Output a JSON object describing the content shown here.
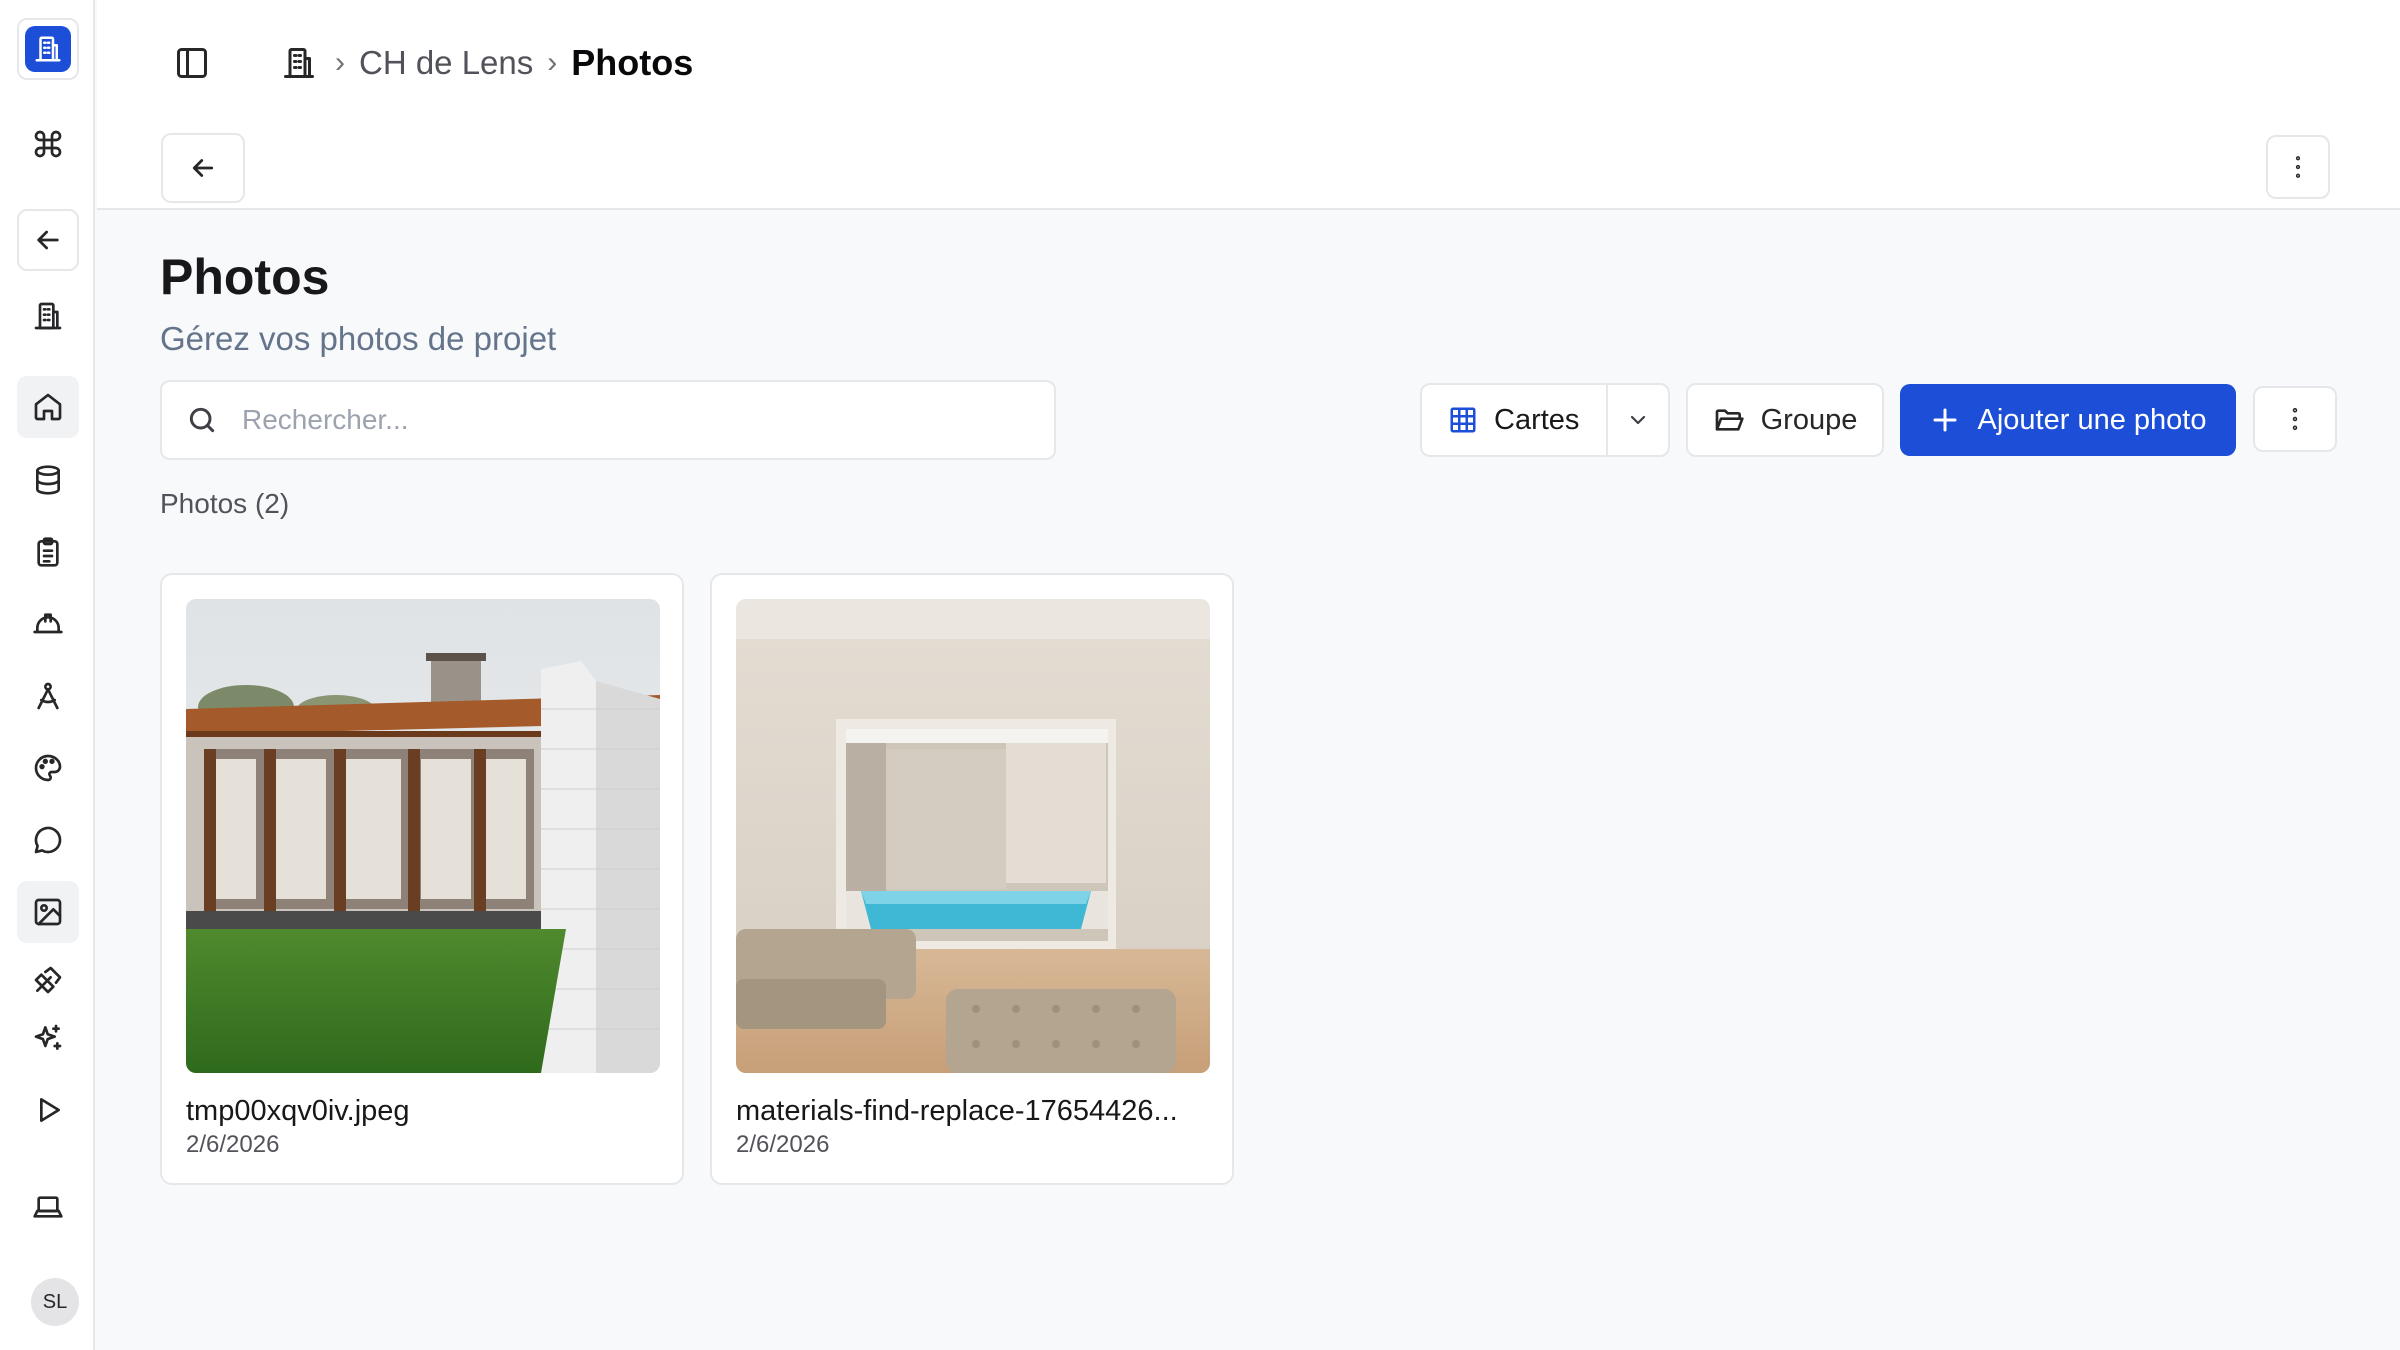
{
  "breadcrumb": {
    "project": "CH de Lens",
    "current": "Photos"
  },
  "header": {
    "title": "Photos",
    "subtitle": "Gérez vos photos de projet"
  },
  "search": {
    "placeholder": "Rechercher...",
    "value": ""
  },
  "toolbar": {
    "view_label": "Cartes",
    "group_label": "Groupe",
    "add_label": "Ajouter une photo"
  },
  "list": {
    "count_label": "Photos (2)"
  },
  "photos": [
    {
      "name": "tmp00xqv0iv.jpeg",
      "date": "2/6/2026",
      "image": "house-exterior-photo"
    },
    {
      "name": "materials-find-replace-17654426...",
      "date": "2/6/2026",
      "image": "interior-pool-photo"
    }
  ],
  "user": {
    "initials": "SL"
  },
  "colors": {
    "accent": "#1d4ed8",
    "border": "#e5e7eb",
    "background": "#f8f9fb"
  },
  "rail_icons": [
    "building-icon",
    "command-icon",
    "arrow-left-icon",
    "building-icon",
    "home-icon",
    "database-icon",
    "clipboard-icon",
    "hard-hat-icon",
    "compass-icon",
    "palette-icon",
    "chat-icon",
    "image-icon",
    "tools-icon",
    "sparkles-icon",
    "play-icon",
    "laptop-icon"
  ]
}
